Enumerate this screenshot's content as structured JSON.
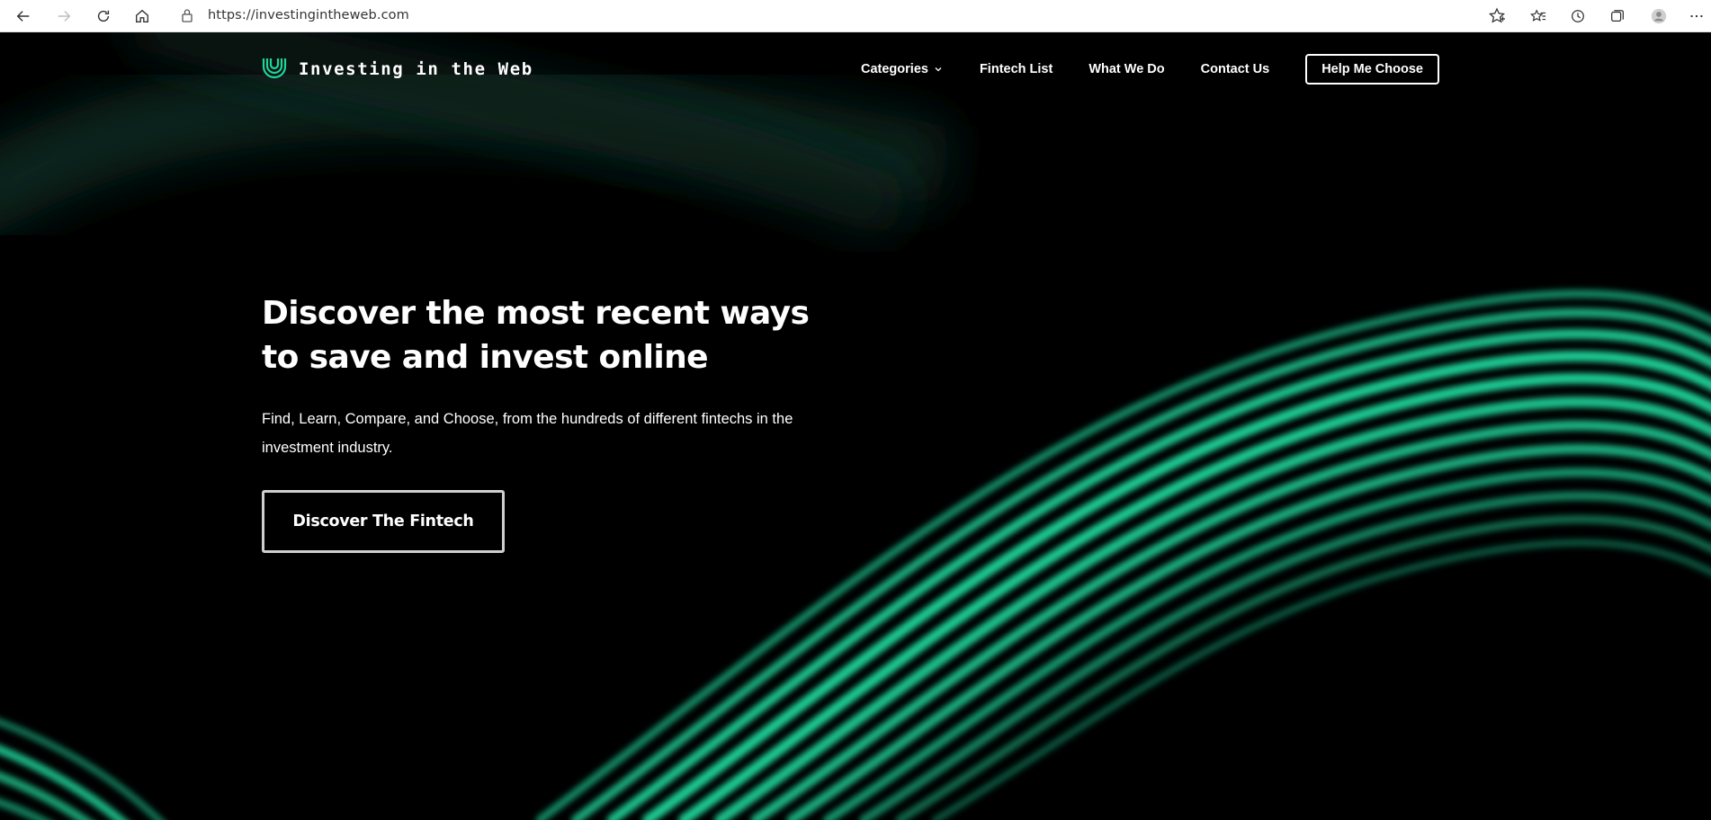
{
  "browser": {
    "url": "https://investingintheweb.com"
  },
  "site": {
    "brand": "Investing in the Web",
    "nav": {
      "categories": "Categories",
      "fintech_list": "Fintech List",
      "what_we_do": "What We Do",
      "contact_us": "Contact Us",
      "help_me_choose": "Help Me Choose"
    }
  },
  "hero": {
    "title": "Discover the most recent ways to save and invest online",
    "subtitle": "Find, Learn, Compare, and Choose, from the hundreds of different fintechs in the investment industry.",
    "cta": "Discover The Fintech"
  },
  "colors": {
    "accent": "#1fd49a",
    "background": "#000000"
  },
  "icons": [
    "back-icon",
    "forward-icon",
    "refresh-icon",
    "home-icon",
    "lock-icon",
    "add-favorite-icon",
    "favorites-icon",
    "history-icon",
    "collections-icon",
    "profile-icon",
    "more-icon"
  ]
}
